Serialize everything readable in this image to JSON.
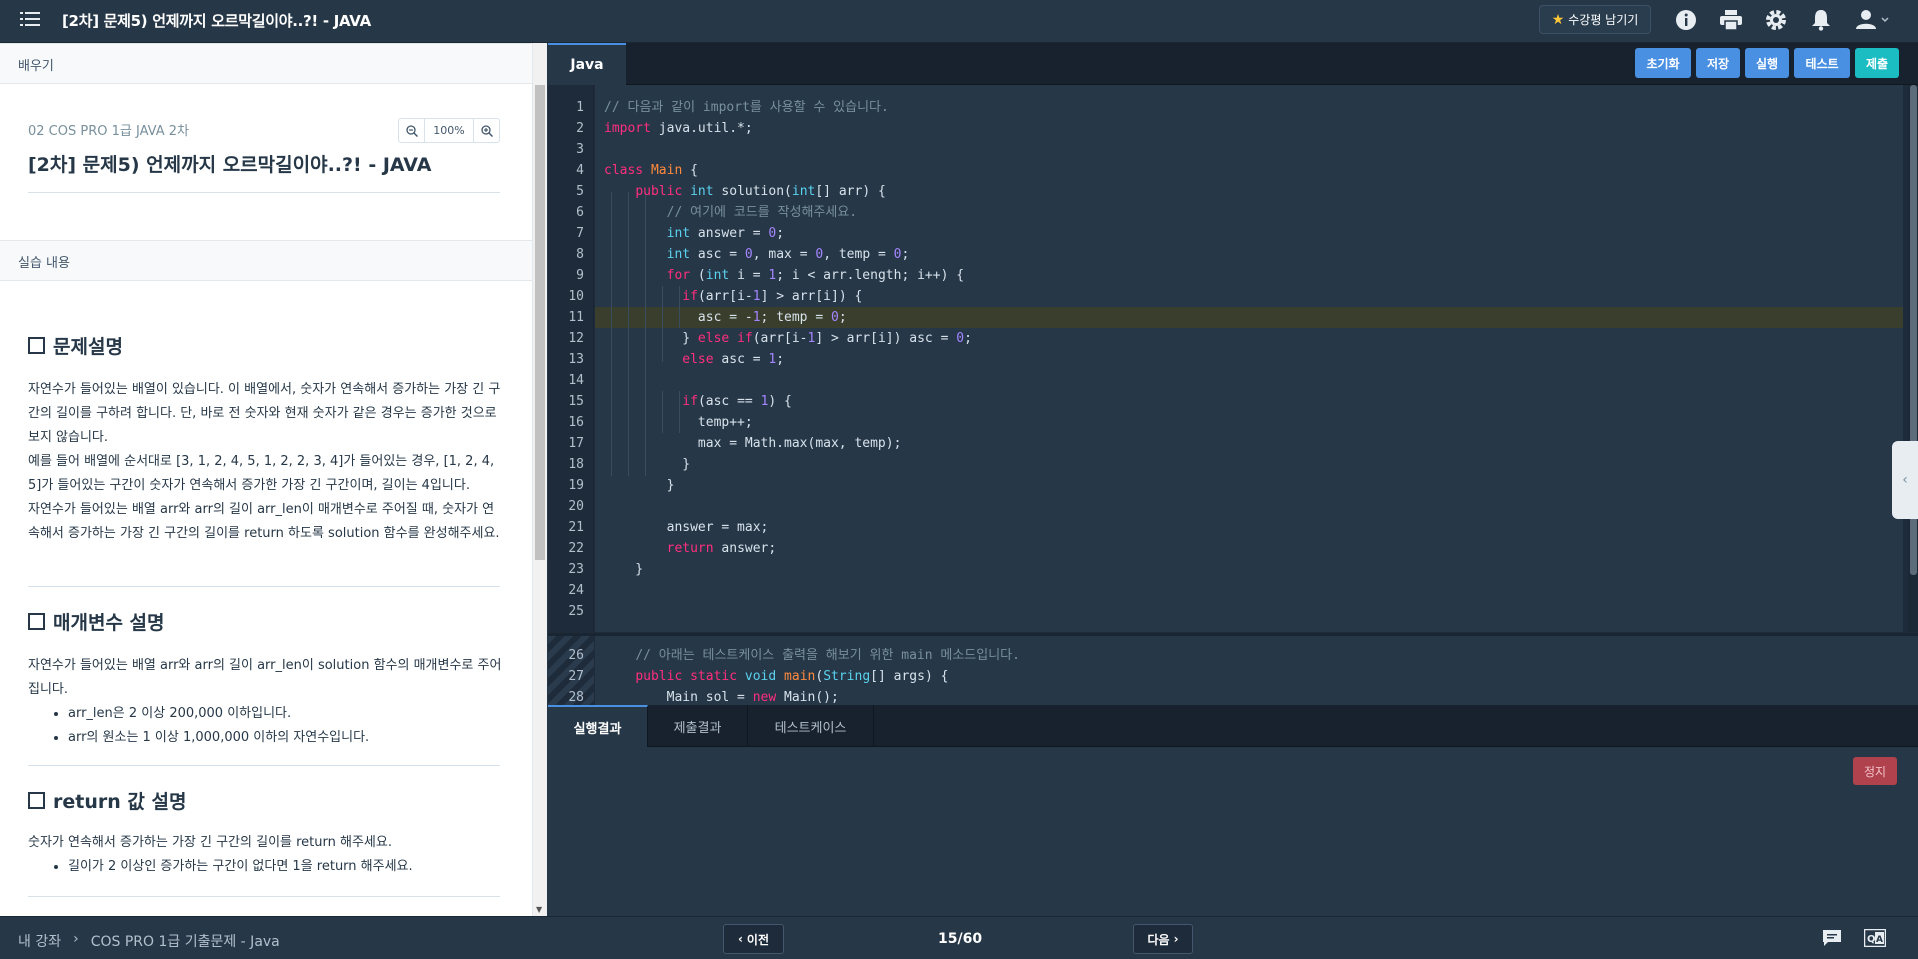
{
  "header": {
    "title": "[2차] 문제5) 언제까지 오르막길이야..?! - JAVA",
    "review_label": "수강평 남기기",
    "icons": [
      "menu-icon",
      "info-icon",
      "print-icon",
      "gear-icon",
      "bell-icon",
      "user-icon"
    ]
  },
  "left": {
    "learn_header": "배우기",
    "course_name": "02 COS PRO 1급 JAVA 2차",
    "zoom_value": "100%",
    "problem_title": "[2차] 문제5) 언제까지 오르막길이야..?! - JAVA",
    "practice_header": "실습 내용",
    "sections": {
      "desc_title": "문제설명",
      "desc_p1": "자연수가 들어있는 배열이 있습니다. 이 배열에서, 숫자가 연속해서 증가하는 가장 긴 구간의 길이를 구하려 합니다. 단, 바로 전 숫자와 현재 숫자가 같은 경우는 증가한 것으로 보지 않습니다.",
      "desc_p2": "예를 들어 배열에 순서대로 [3, 1, 2, 4, 5, 1, 2, 2, 3, 4]가 들어있는 경우, [1, 2, 4, 5]가 들어있는 구간이 숫자가 연속해서 증가한 가장 긴 구간이며, 길이는 4입니다.",
      "desc_p3": "자연수가 들어있는 배열 arr와 arr의 길이 arr_len이 매개변수로 주어질 때, 숫자가 연속해서 증가하는 가장 긴 구간의 길이를 return 하도록 solution 함수를 완성해주세요.",
      "param_title": "매개변수 설명",
      "param_p": "자연수가 들어있는 배열 arr와 arr의 길이 arr_len이 solution 함수의 매개변수로 주어집니다.",
      "param_b1": "arr_len은 2 이상 200,000 이하입니다.",
      "param_b2": "arr의 원소는 1 이상 1,000,000 이하의 자연수입니다.",
      "return_title": "return 값 설명",
      "return_p": "숫자가 연속해서 증가하는 가장 긴 구간의 길이를 return 해주세요.",
      "return_b1": "길이가 2 이상인 증가하는 구간이 없다면 1을 return 해주세요."
    }
  },
  "editor": {
    "tab_label": "Java",
    "buttons": {
      "reset": "초기화",
      "save": "저장",
      "run": "실행",
      "test": "테스트",
      "submit": "제출"
    },
    "line_numbers": [
      "1",
      "2",
      "3",
      "4",
      "5",
      "6",
      "7",
      "8",
      "9",
      "10",
      "11",
      "12",
      "13",
      "14",
      "15",
      "16",
      "17",
      "18",
      "19",
      "20",
      "21",
      "22",
      "23",
      "24",
      "25"
    ],
    "line_numbers2": [
      "26",
      "27",
      "28"
    ]
  },
  "results": {
    "tabs": [
      "실행결과",
      "제출결과",
      "테스트케이스"
    ],
    "stop_label": "정지"
  },
  "footer": {
    "crumb_home": "내 강좌",
    "crumb_sep": "›",
    "crumb_course": "COS PRO 1급 기출문제 - Java",
    "prev_label": "이전",
    "next_label": "다음",
    "page_count": "15/60"
  },
  "colors": {
    "accent": "#4a90e2",
    "submit": "#1cbcc3",
    "keyword": "#ff2e7e",
    "type": "#5bd2ef",
    "number": "#a585ff"
  }
}
